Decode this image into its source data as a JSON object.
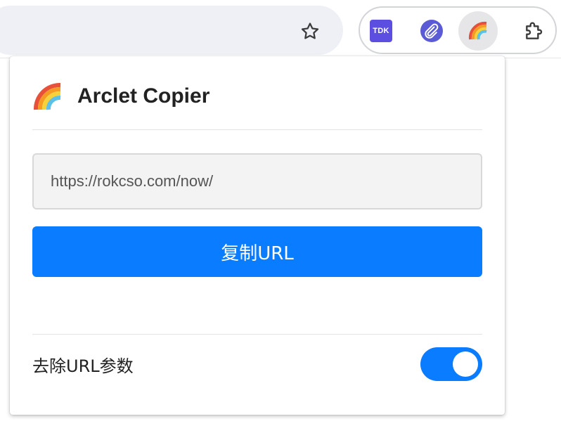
{
  "browser": {
    "bookmark_icon": "star-outline-icon",
    "extensions": [
      {
        "name": "tdk-extension",
        "label": "TDK",
        "color": "#5b4ee0"
      },
      {
        "name": "paperclip-extension",
        "icon": "paperclip-icon",
        "color": "#5b5bd6"
      },
      {
        "name": "arclet-copier-extension",
        "icon": "rainbow-icon",
        "active": true
      }
    ],
    "extensions_menu_icon": "puzzle-icon"
  },
  "popup": {
    "logo_icon": "rainbow-icon",
    "title": "Arclet Copier",
    "url_value": "https://rokcso.com/now/",
    "copy_button_label": "复制URL",
    "remove_params_label": "去除URL参数",
    "remove_params_enabled": true,
    "accent_color": "#0a7cff"
  }
}
